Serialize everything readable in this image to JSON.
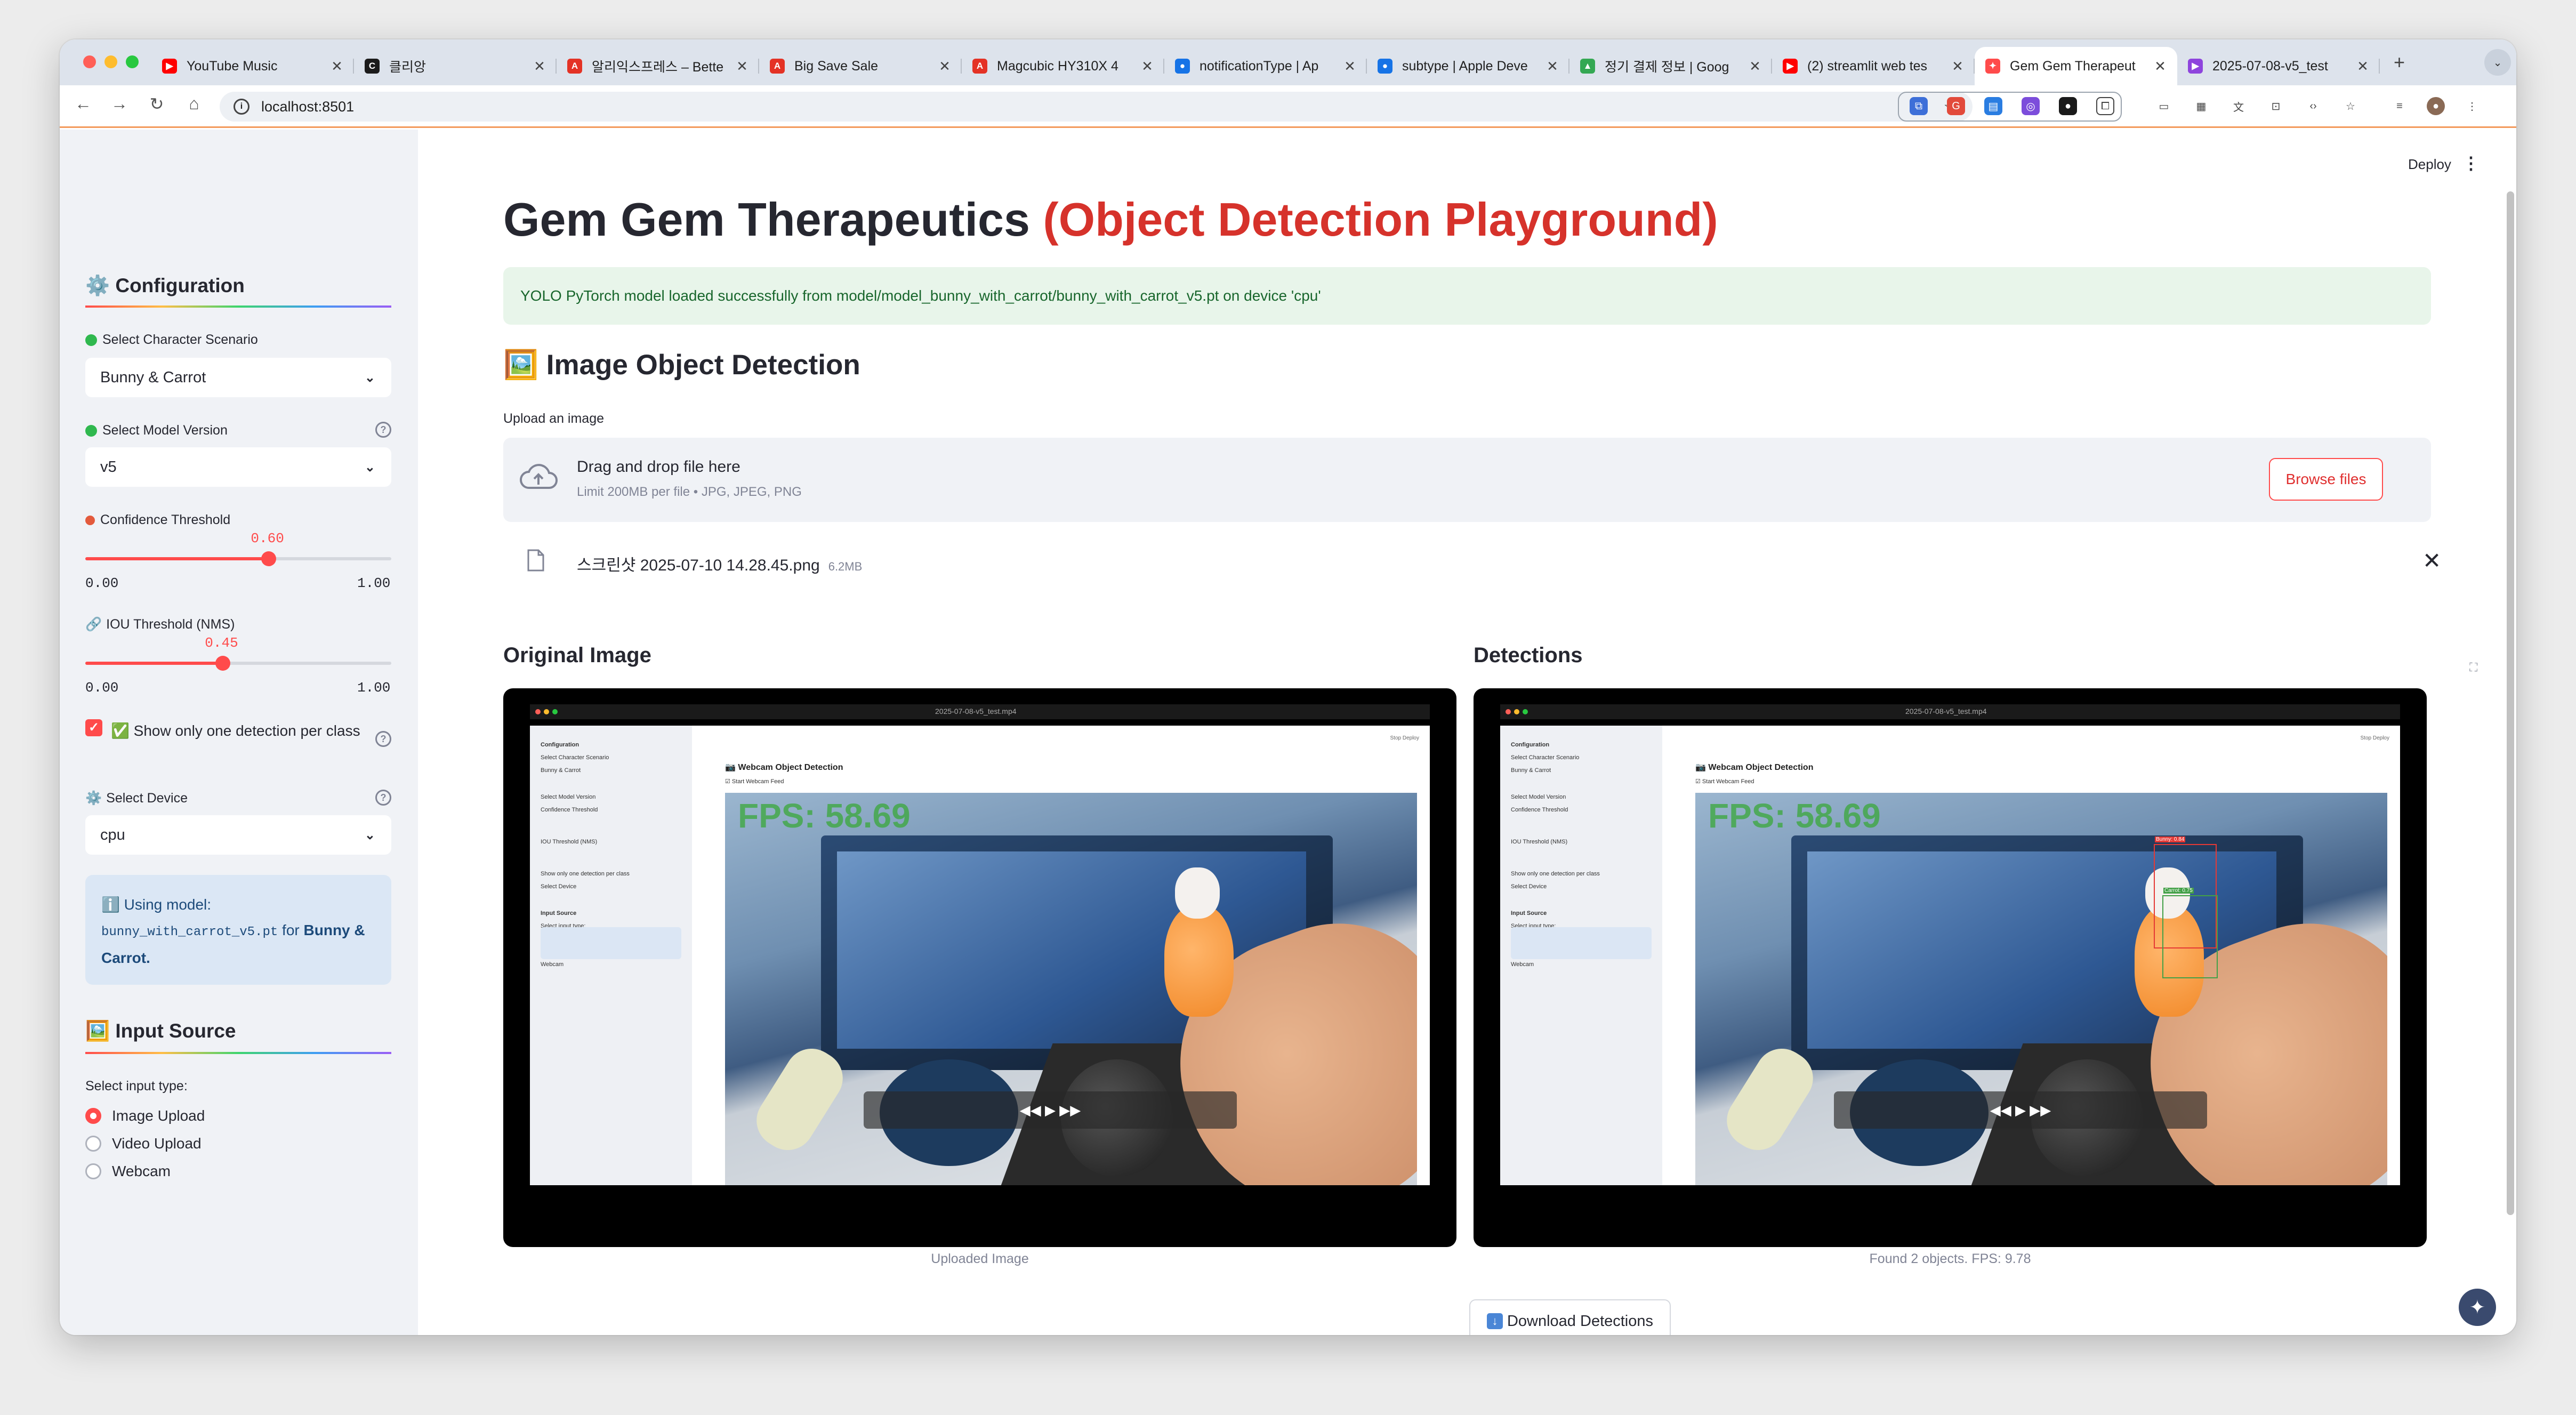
{
  "browser": {
    "tabs": [
      {
        "title": "YouTube Music",
        "color": "#ff0000",
        "glyph": "▶"
      },
      {
        "title": "클리앙",
        "color": "#1b1b1b",
        "glyph": "C"
      },
      {
        "title": "알리익스프레스 – Bette",
        "color": "#e43225",
        "glyph": "A"
      },
      {
        "title": "Big Save Sale",
        "color": "#e43225",
        "glyph": "A"
      },
      {
        "title": "Magcubic HY310X 4",
        "color": "#e43225",
        "glyph": "A"
      },
      {
        "title": "notificationType | Ap",
        "color": "#1673e6",
        "glyph": "●"
      },
      {
        "title": "subtype | Apple Deve",
        "color": "#1673e6",
        "glyph": "●"
      },
      {
        "title": "정기 결제 정보 | Goog",
        "color": "#34a853",
        "glyph": "▲"
      },
      {
        "title": "(2) streamlit web tes",
        "color": "#ff0000",
        "glyph": "▶"
      },
      {
        "title": "Gem Gem Therapeut",
        "color": "#ff4b4b",
        "glyph": "✦"
      },
      {
        "title": "2025-07-08-v5_test",
        "color": "#8e44dd",
        "glyph": "▶"
      }
    ],
    "active_tab": "Gem Gem Therapeut",
    "url": "localhost:8501",
    "new_tab_glyph": "+",
    "close_glyph": "✕"
  },
  "app": {
    "deploy_label": "Deploy",
    "menu_glyph": "⋮",
    "title_main": "Gem Gem Therapeutics",
    "title_accent": "(Object Detection Playground)",
    "success_message": "YOLO PyTorch model loaded successfully from model/model_bunny_with_carrot/bunny_with_carrot_v5.pt on device 'cpu'",
    "section_heading": "Image Object Detection",
    "upload_label": "Upload an image",
    "dropzone": {
      "title": "Drag and drop file here",
      "limit": "Limit 200MB per file • JPG, JPEG, PNG",
      "browse_label": "Browse files"
    },
    "uploaded_file": {
      "name": "스크린샷 2025-07-10 14.28.45.png",
      "size": "6.2MB"
    },
    "original_heading": "Original Image",
    "detections_heading": "Detections",
    "original_caption": "Uploaded Image",
    "detections_caption": "Found 2 objects. FPS: 9.78",
    "download_label": "Download Detections"
  },
  "sidebar": {
    "config_heading": "Configuration",
    "scenario_label": "Select Character Scenario",
    "scenario_value": "Bunny & Carrot",
    "model_label": "Select Model Version",
    "model_value": "v5",
    "conf_label": "Confidence Threshold",
    "conf_value": 0.6,
    "conf_display": "0.60",
    "iou_label": "IOU Threshold (NMS)",
    "iou_value": 0.45,
    "iou_display": "0.45",
    "range_min": "0.00",
    "range_max": "1.00",
    "one_per_class_label": "✅ Show only one detection per class",
    "one_per_class_checked": true,
    "device_label": "Select Device",
    "device_value": "cpu",
    "info_prefix": "ℹ️ Using model:",
    "info_model": "bunny_with_carrot_v5.pt",
    "info_for": "for",
    "info_scenario": "Bunny & Carrot.",
    "input_heading": "Input Source",
    "input_type_label": "Select input type:",
    "input_options": [
      "Image Upload",
      "Video Upload",
      "Webcam"
    ],
    "input_selected": "Image Upload"
  },
  "screenshot_content": {
    "file_title": "2025-07-08-v5_test.mp4",
    "heading": "Webcam Object Detection",
    "start_label": "Start Webcam Feed",
    "fps_overlay": "FPS: 58.69",
    "mini_sidebar_labels": [
      "Configuration",
      "Select Character Scenario",
      "Bunny & Carrot",
      "Select Model Version",
      "Confidence Threshold",
      "IOU Threshold (NMS)",
      "Show only one detection per class",
      "Select Device",
      "Input Source",
      "Select input type:",
      "Image Upload",
      "Video Upload",
      "Webcam"
    ],
    "mini_topbar": "Stop   Deploy",
    "player_controls": "◀◀  ▶  ▶▶",
    "detection_labels": [
      "Bunny: 0.84",
      "Carrot: 0.75"
    ]
  }
}
